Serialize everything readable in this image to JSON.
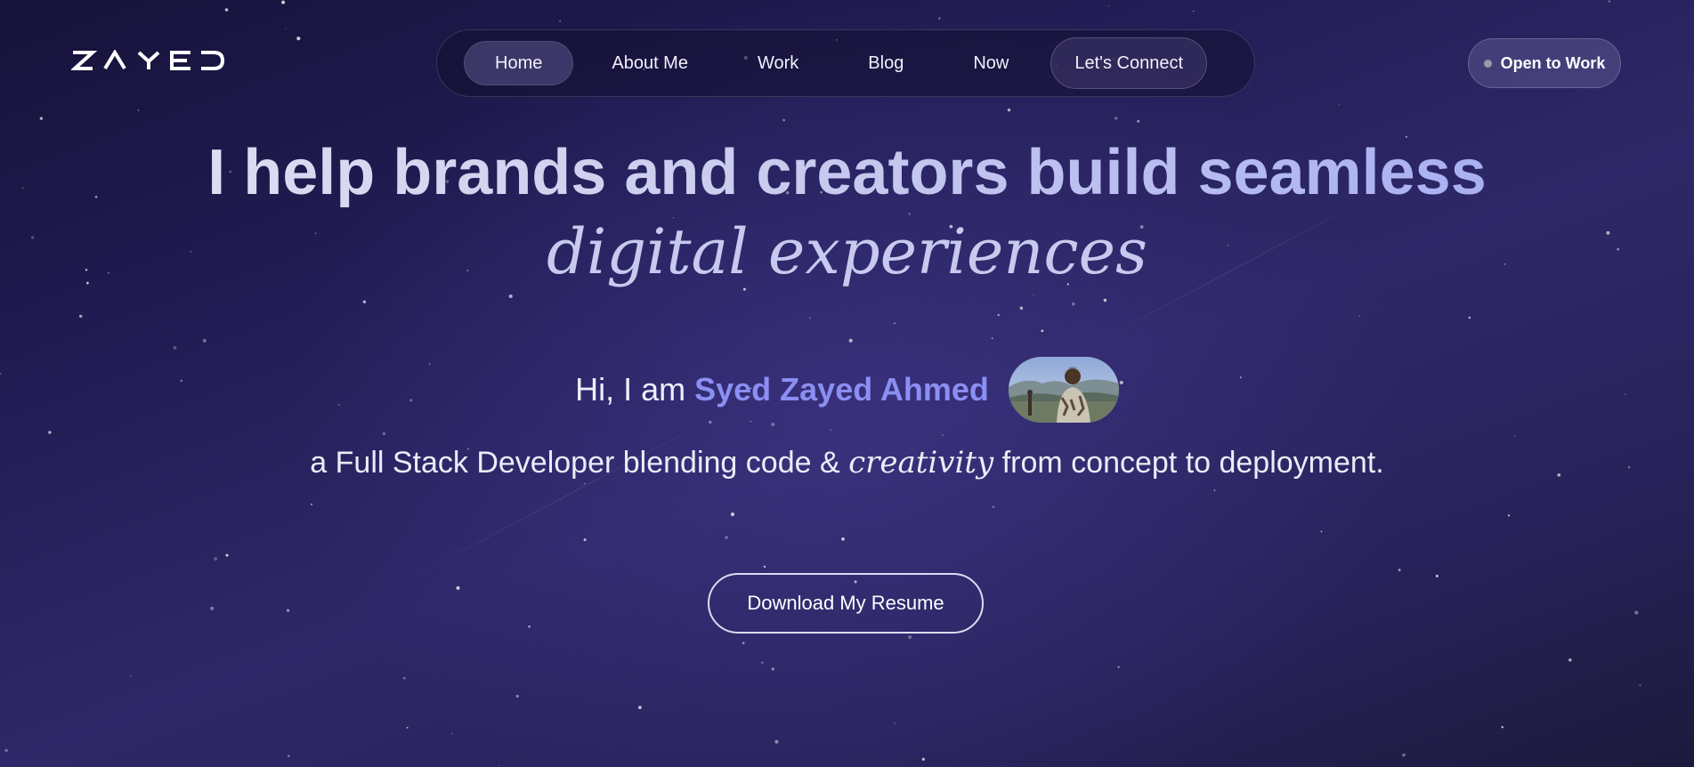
{
  "header": {
    "logo_text": "ZAYED",
    "nav_items": [
      {
        "label": "Home",
        "active": true
      },
      {
        "label": "About Me",
        "active": false
      },
      {
        "label": "Work",
        "active": false
      },
      {
        "label": "Blog",
        "active": false
      },
      {
        "label": "Now",
        "active": false
      }
    ],
    "connect_label": "Let's Connect",
    "status_label": "Open to Work",
    "status_color": "#9a9aa6"
  },
  "hero": {
    "headline": "I help brands and creators build seamless",
    "headline_em": "digital experiences",
    "intro_prefix": "Hi, I am ",
    "intro_name": "Syed Zayed Ahmed",
    "avatar_icon": "profile-photo",
    "subline_before": "a Full Stack Developer blending code & ",
    "subline_em": "creativity",
    "subline_after": " from concept to deployment.",
    "resume_label": "Download My Resume"
  },
  "colors": {
    "accent_name": "#8b8ef2",
    "headline_gradient_end": "#a9b0f2",
    "background": "#2a2460"
  }
}
